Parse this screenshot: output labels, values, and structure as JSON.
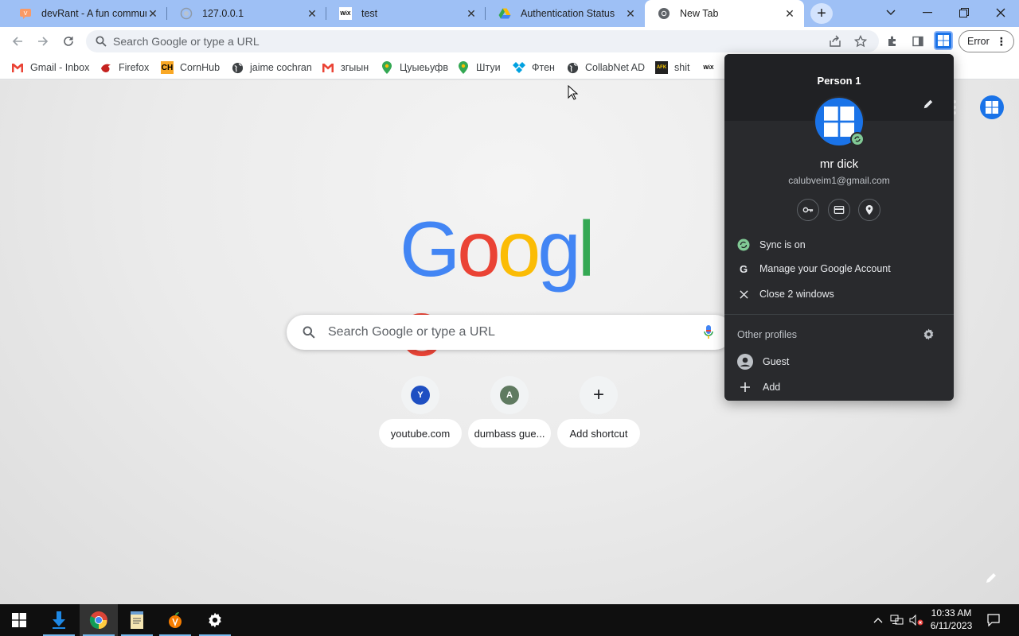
{
  "tabs": [
    {
      "title": "devRant - A fun community for developers",
      "favicon": "devrant-icon",
      "color": "#f99a66"
    },
    {
      "title": "127.0.0.1",
      "favicon": "globe-icon"
    },
    {
      "title": "test",
      "favicon": "wix-icon"
    },
    {
      "title": "Authentication Status",
      "favicon": "google-drive-icon"
    },
    {
      "title": "New Tab",
      "favicon": "chrome-icon",
      "active": true
    }
  ],
  "toolbar": {
    "omnibox_placeholder": "Search Google or type a URL",
    "error_label": "Error"
  },
  "bookmarks": [
    {
      "label": "Gmail - Inbox",
      "icon": "gmail-icon"
    },
    {
      "label": "Firefox",
      "icon": "bird-icon"
    },
    {
      "label": "CornHub",
      "icon": "ch-icon"
    },
    {
      "label": "jaime cochran",
      "icon": "globe-icon"
    },
    {
      "label": "згыын",
      "icon": "gmail-icon"
    },
    {
      "label": "Цуыеьуфв",
      "icon": "maps-icon"
    },
    {
      "label": "Штуи",
      "icon": "maps-icon"
    },
    {
      "label": "Фтен",
      "icon": "diamond-icon"
    },
    {
      "label": "CollabNet AD",
      "icon": "globe-icon"
    },
    {
      "label": "shit",
      "icon": "afk-icon"
    },
    {
      "label": "",
      "icon": "wix-icon"
    }
  ],
  "newtab": {
    "search_placeholder": "Search Google or type a URL",
    "shortcuts": [
      {
        "letter": "Y",
        "label": "youtube.com",
        "color": "#1e4fc2"
      },
      {
        "letter": "A",
        "label": "dumbass gue...",
        "color": "#5f7a60"
      },
      {
        "letter": "+",
        "label": "Add shortcut"
      }
    ]
  },
  "profile_panel": {
    "profile_name": "Person 1",
    "user_name": "mr dick",
    "email": "calubveim1@gmail.com",
    "sync_label": "Sync is on",
    "manage_label": "Manage your Google Account",
    "close_label": "Close 2 windows",
    "other_profiles_label": "Other profiles",
    "guest_label": "Guest",
    "add_label": "Add"
  },
  "taskbar": {
    "time": "10:33 AM",
    "date": "6/11/2023"
  },
  "colors": {
    "tabstrip": "#9ec0f5",
    "accent": "#1a73e8",
    "panel_bg": "#292a2d"
  }
}
